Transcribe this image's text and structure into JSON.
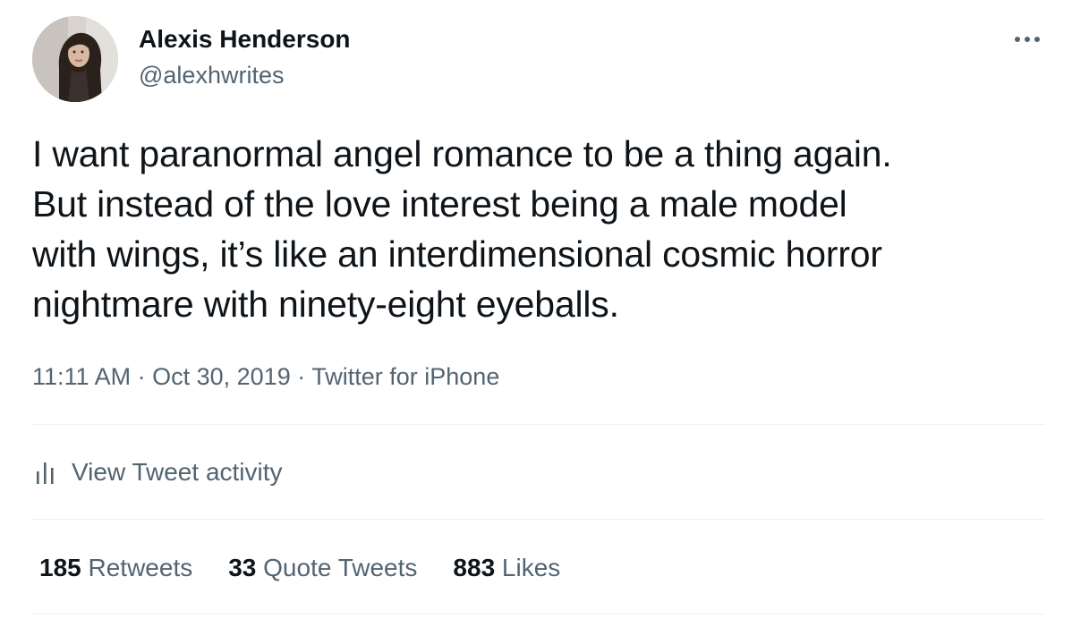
{
  "author": {
    "display_name": "Alexis Henderson",
    "handle": "@alexhwrites"
  },
  "more_icon": "more-horizontal-icon",
  "tweet": {
    "lines": [
      "I want paranormal angel romance to be a thing again.",
      "But instead of the love interest being a male model",
      "with wings, it’s like an interdimensional cosmic horror",
      "nightmare with ninety-eight eyeballs."
    ]
  },
  "meta": {
    "time": "11:11 AM",
    "separator": "·",
    "date": "Oct 30, 2019",
    "source": "Twitter for iPhone"
  },
  "activity": {
    "icon": "analytics-bars-icon",
    "label": "View Tweet activity"
  },
  "stats": {
    "retweets_count": "185",
    "retweets_label": "Retweets",
    "quotes_count": "33",
    "quotes_label": "Quote Tweets",
    "likes_count": "883",
    "likes_label": "Likes"
  },
  "colors": {
    "text_primary": "#0f1419",
    "text_secondary": "#536471",
    "divider": "#eff3f4",
    "background": "#ffffff"
  }
}
